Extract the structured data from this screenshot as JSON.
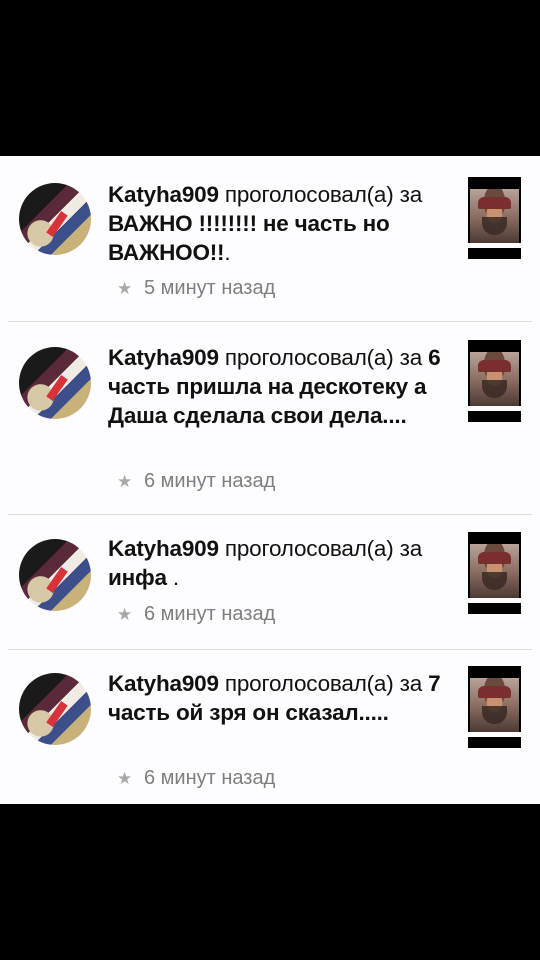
{
  "feed": {
    "items": [
      {
        "username": "Katyha909",
        "verb": " проголосовал(а) за ",
        "target": "ВАЖНО !!!!!!!! не часть но ВАЖНОО!!",
        "tail": ".",
        "time": "5 минут назад",
        "icons": {
          "avatar": "user-avatar",
          "star": "star-icon",
          "thumb": "poll-image"
        }
      },
      {
        "username": "Katyha909",
        "verb": " проголосовал(а) за ",
        "target": "6 часть пришла на дескотеку а Даша сделала свои дела....",
        "tail": "",
        "time": "6 минут назад",
        "icons": {
          "avatar": "user-avatar",
          "star": "star-icon",
          "thumb": "poll-image"
        }
      },
      {
        "username": "Katyha909",
        "verb": " проголосовал(а) за ",
        "target": "инфа",
        "tail": " .",
        "time": "6 минут назад",
        "icons": {
          "avatar": "user-avatar",
          "star": "star-icon",
          "thumb": "poll-image"
        }
      },
      {
        "username": "Katyha909",
        "verb": " проголосовал(а) за ",
        "target": "7 часть ой зря он сказал.....",
        "tail": "",
        "time": "6 минут назад",
        "icons": {
          "avatar": "user-avatar",
          "star": "star-icon",
          "thumb": "poll-image"
        }
      }
    ],
    "star_glyph": "★"
  }
}
